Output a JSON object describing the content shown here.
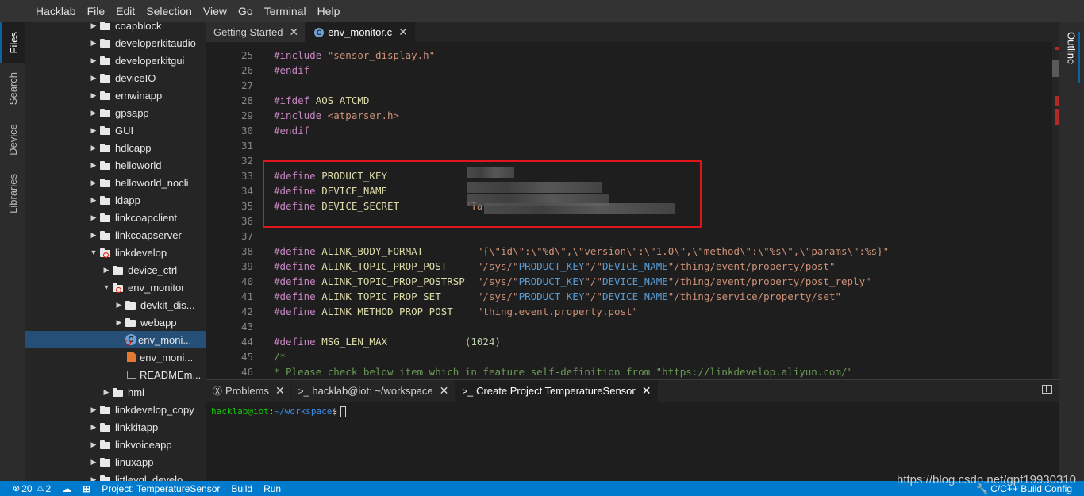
{
  "menubar": {
    "items": [
      "Hacklab",
      "File",
      "Edit",
      "Selection",
      "View",
      "Go",
      "Terminal",
      "Help"
    ]
  },
  "activitybar": {
    "tabs": [
      "Files",
      "Search",
      "Device",
      "Libraries"
    ]
  },
  "outline": {
    "label": "Outline"
  },
  "explorer": {
    "items": [
      {
        "label": "coapblock",
        "kind": "folder"
      },
      {
        "label": "developerkitaudio",
        "kind": "folder"
      },
      {
        "label": "developerkitgui",
        "kind": "folder"
      },
      {
        "label": "deviceIO",
        "kind": "folder"
      },
      {
        "label": "emwinapp",
        "kind": "folder"
      },
      {
        "label": "gpsapp",
        "kind": "folder"
      },
      {
        "label": "GUI",
        "kind": "folder"
      },
      {
        "label": "hdlcapp",
        "kind": "folder"
      },
      {
        "label": "helloworld",
        "kind": "folder"
      },
      {
        "label": "helloworld_nocli",
        "kind": "folder"
      },
      {
        "label": "ldapp",
        "kind": "folder"
      },
      {
        "label": "linkcoapclient",
        "kind": "folder"
      },
      {
        "label": "linkcoapserver",
        "kind": "folder"
      },
      {
        "label": "linkdevelop",
        "kind": "folder",
        "expanded": true,
        "error": true
      },
      {
        "label": "device_ctrl",
        "kind": "folder"
      },
      {
        "label": "env_monitor",
        "kind": "folder",
        "expanded": true,
        "error": true
      },
      {
        "label": "devkit_dis...",
        "kind": "folder"
      },
      {
        "label": "webapp",
        "kind": "folder"
      },
      {
        "label": "env_moni...",
        "kind": "c-file",
        "selected": true,
        "error": true
      },
      {
        "label": "env_moni...",
        "kind": "h-file"
      },
      {
        "label": "READMEm...",
        "kind": "md-file"
      },
      {
        "label": "hmi",
        "kind": "folder"
      },
      {
        "label": "linkdevelop_copy",
        "kind": "folder"
      },
      {
        "label": "linkkitapp",
        "kind": "folder"
      },
      {
        "label": "linkvoiceapp",
        "kind": "folder"
      },
      {
        "label": "linuxapp",
        "kind": "folder"
      },
      {
        "label": "littlevgl_develo...",
        "kind": "folder"
      }
    ]
  },
  "editor_tabs": [
    {
      "label": "Getting Started",
      "active": false
    },
    {
      "label": "env_monitor.c",
      "active": true,
      "icon": "c-file-icon"
    }
  ],
  "editor": {
    "lines": [
      {
        "n": "25",
        "parts": [
          [
            "pp",
            "#include "
          ],
          [
            "str",
            "\"sensor_display.h\""
          ]
        ]
      },
      {
        "n": "26",
        "parts": [
          [
            "pp",
            "#endif"
          ]
        ]
      },
      {
        "n": "27",
        "parts": []
      },
      {
        "n": "28",
        "parts": [
          [
            "pp",
            "#ifdef "
          ],
          [
            "id",
            "AOS_ATCMD"
          ]
        ]
      },
      {
        "n": "29",
        "parts": [
          [
            "pp",
            "#include "
          ],
          [
            "str",
            "<atparser.h>"
          ]
        ]
      },
      {
        "n": "30",
        "parts": [
          [
            "pp",
            "#endif"
          ]
        ]
      },
      {
        "n": "31",
        "parts": []
      },
      {
        "n": "32",
        "parts": []
      },
      {
        "n": "33",
        "parts": [
          [
            "pp",
            "#define "
          ],
          [
            "id",
            "PRODUCT_KEY"
          ]
        ]
      },
      {
        "n": "34",
        "parts": [
          [
            "pp",
            "#define "
          ],
          [
            "id",
            "DEVICE_NAME"
          ]
        ]
      },
      {
        "n": "35",
        "parts": [
          [
            "pp",
            "#define "
          ],
          [
            "id",
            "DEVICE_SECRET"
          ],
          [
            "txt",
            "           "
          ],
          [
            "str",
            "\"Ta"
          ]
        ]
      },
      {
        "n": "36",
        "parts": []
      },
      {
        "n": "37",
        "parts": []
      },
      {
        "n": "38",
        "parts": [
          [
            "pp",
            "#define "
          ],
          [
            "id",
            "ALINK_BODY_FORMAT"
          ],
          [
            "txt",
            "         "
          ],
          [
            "str",
            "\"{\\\"id\\\":\\\"%d\\\",\\\"version\\\":\\\"1.0\\\",\\\"method\\\":\\\"%s\\\",\\\"params\\\":%s}\""
          ]
        ]
      },
      {
        "n": "39",
        "parts": [
          [
            "pp",
            "#define "
          ],
          [
            "id",
            "ALINK_TOPIC_PROP_POST"
          ],
          [
            "txt",
            "     "
          ],
          [
            "str",
            "\"/sys/\""
          ],
          [
            "kw",
            "PRODUCT_KEY"
          ],
          [
            "str",
            "\"/\""
          ],
          [
            "kw",
            "DEVICE_NAME"
          ],
          [
            "str",
            "\"/thing/event/property/post\""
          ]
        ]
      },
      {
        "n": "40",
        "parts": [
          [
            "pp",
            "#define "
          ],
          [
            "id",
            "ALINK_TOPIC_PROP_POSTRSP"
          ],
          [
            "txt",
            "  "
          ],
          [
            "str",
            "\"/sys/\""
          ],
          [
            "kw",
            "PRODUCT_KEY"
          ],
          [
            "str",
            "\"/\""
          ],
          [
            "kw",
            "DEVICE_NAME"
          ],
          [
            "str",
            "\"/thing/event/property/post_reply\""
          ]
        ]
      },
      {
        "n": "41",
        "parts": [
          [
            "pp",
            "#define "
          ],
          [
            "id",
            "ALINK_TOPIC_PROP_SET"
          ],
          [
            "txt",
            "      "
          ],
          [
            "str",
            "\"/sys/\""
          ],
          [
            "kw",
            "PRODUCT_KEY"
          ],
          [
            "str",
            "\"/\""
          ],
          [
            "kw",
            "DEVICE_NAME"
          ],
          [
            "str",
            "\"/thing/service/property/set\""
          ]
        ]
      },
      {
        "n": "42",
        "parts": [
          [
            "pp",
            "#define "
          ],
          [
            "id",
            "ALINK_METHOD_PROP_POST"
          ],
          [
            "txt",
            "    "
          ],
          [
            "str",
            "\"thing.event.property.post\""
          ]
        ]
      },
      {
        "n": "43",
        "parts": []
      },
      {
        "n": "44",
        "parts": [
          [
            "pp",
            "#define "
          ],
          [
            "id",
            "MSG_LEN_MAX"
          ],
          [
            "txt",
            "             "
          ],
          [
            "num",
            "(1024)"
          ]
        ]
      },
      {
        "n": "45",
        "parts": [
          [
            "cm",
            "/*"
          ]
        ]
      },
      {
        "n": "46",
        "parts": [
          [
            "cm",
            "* Please check below item which in feature self-definition from \"https://linkdevelop.aliyun.com/\""
          ]
        ]
      }
    ]
  },
  "panel_tabs": [
    {
      "label": "Problems",
      "icon": "Ⓧ",
      "active": false
    },
    {
      "label": "hacklab@iot: ~/workspace",
      "icon": ">_",
      "active": false
    },
    {
      "label": "Create Project TemperatureSensor",
      "icon": ">_",
      "active": true
    }
  ],
  "terminal": {
    "user": "hacklab@iot",
    "sep": ":",
    "path": "~/workspace",
    "dollar": "$"
  },
  "statusbar": {
    "errors": "20",
    "warnings": "2",
    "project": "Project: TemperatureSensor",
    "build": "Build",
    "run": "Run",
    "build_config": "C/C++ Build Config"
  },
  "watermark": "https://blog.csdn.net/gpf19930310",
  "colors": {
    "accent": "#007acc",
    "highlight_box": "#e0161b",
    "selection": "#264f78"
  }
}
